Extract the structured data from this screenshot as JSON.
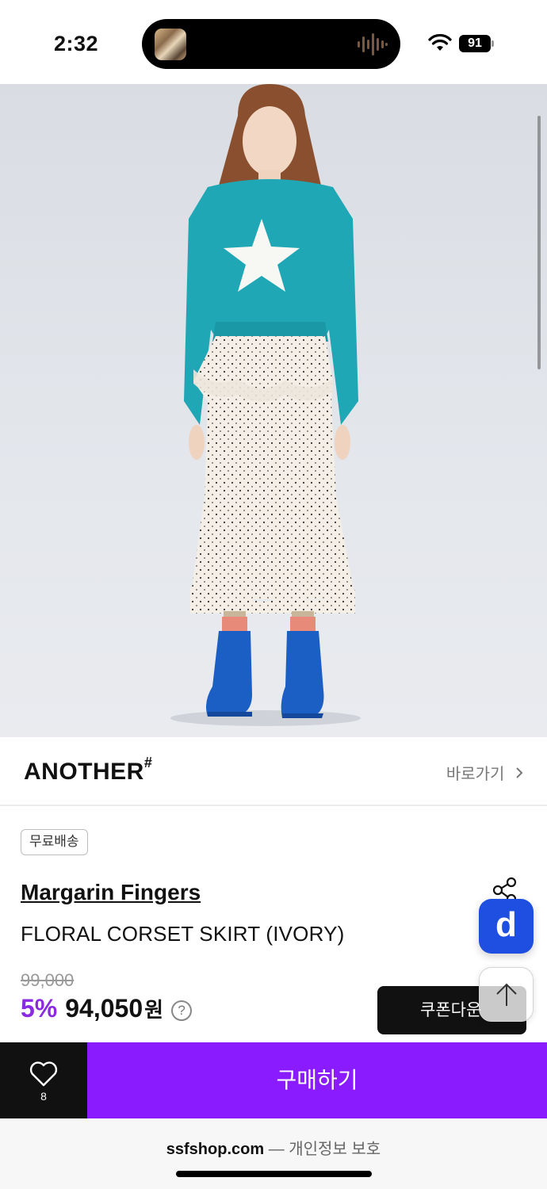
{
  "status_bar": {
    "time": "2:32",
    "battery": "91",
    "icons": [
      "island-thumbnail",
      "audio-wave-icon",
      "wifi-icon",
      "battery-icon"
    ]
  },
  "product": {
    "image_icon": "product-photo",
    "store": {
      "logo": "ANOTHER",
      "logo_mark": "#",
      "link_label": "바로가기",
      "link_icon": "chevron-right-icon"
    },
    "badge": "무료배송",
    "brand": "Margarin Fingers",
    "name": "FLORAL CORSET SKIRT (IVORY)",
    "original_price": "99,000",
    "discount": "5%",
    "price": "94,050",
    "currency": "원",
    "help_icon": "?",
    "coupon_label": "쿠폰다운"
  },
  "floating": {
    "d_label": "d",
    "top_icon": "arrow-up-icon",
    "share_icon": "share-icon"
  },
  "bottom_bar": {
    "like_count": "8",
    "buy_label": "구매하기"
  },
  "browser": {
    "domain": "ssfshop.com",
    "separator": "—",
    "subtitle": "개인정보 보호"
  },
  "colors": {
    "purple": "#8b1bff",
    "discount": "#8a2be2",
    "blue": "#1f4fe0"
  }
}
